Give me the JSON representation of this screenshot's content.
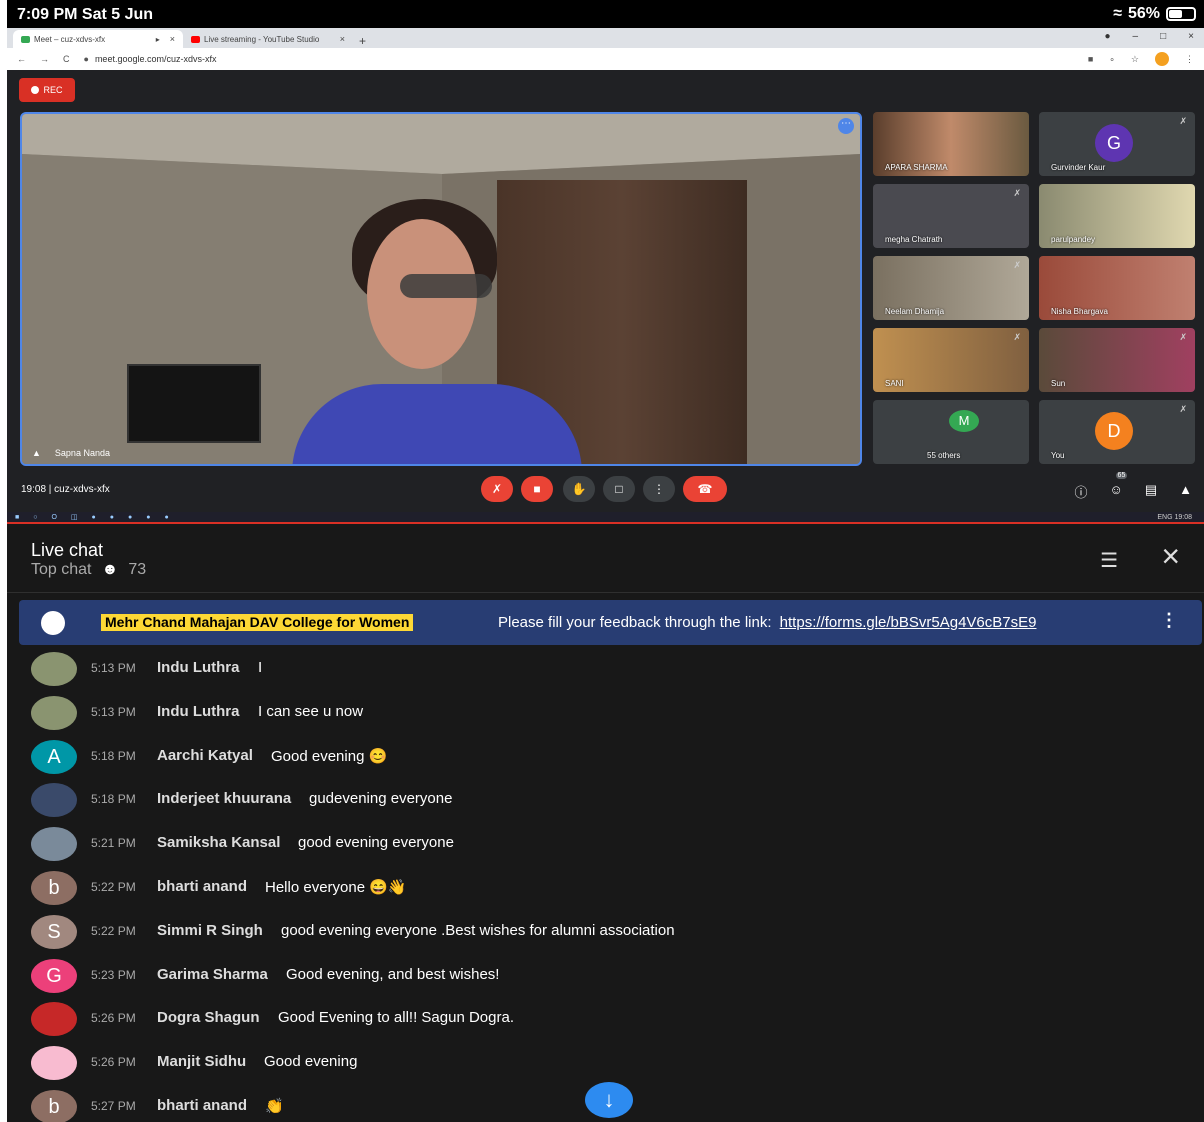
{
  "status_bar": {
    "time": "7:09 PM  Sat 5 Jun",
    "battery": "56%",
    "battery_level": 0.56
  },
  "browser": {
    "tabs": [
      {
        "label": "Meet – cuz-xdvs-xfx",
        "active": true,
        "color": "#34a853"
      },
      {
        "label": "Live streaming - YouTube Studio",
        "active": false,
        "color": "#ff0000"
      }
    ],
    "url": "meet.google.com/cuz-xdvs-xfx"
  },
  "meet": {
    "rec_label": "REC",
    "main_participant": "Sapna Nanda",
    "tiles": [
      {
        "name": "APARA SHARMA",
        "type": "video"
      },
      {
        "name": "Gurvinder Kaur",
        "type": "avatar",
        "initial": "G",
        "color": "#5e35b1"
      },
      {
        "name": "megha Chatrath",
        "type": "video"
      },
      {
        "name": "parulpandey",
        "type": "video"
      },
      {
        "name": "Neelam Dhamija",
        "type": "video"
      },
      {
        "name": "Nisha Bhargava",
        "type": "video"
      },
      {
        "name": "SANI",
        "type": "video"
      },
      {
        "name": "Sun",
        "type": "video"
      },
      {
        "name": "55 others",
        "type": "avatar",
        "initial": "M",
        "color": "#34a853"
      },
      {
        "name": "You",
        "type": "avatar",
        "initial": "D",
        "color": "#f4811f"
      }
    ],
    "meeting_info": "19:08  |  cuz-xdvs-xfx",
    "participant_count": "65"
  },
  "taskbar": {
    "clock": "ENG  19:08"
  },
  "live_chat": {
    "title": "Live chat",
    "mode": "Top chat",
    "viewer_count": "73",
    "pinned": {
      "author": "Mehr Chand Mahajan DAV College for Women",
      "message": "Please fill your feedback through the link:",
      "link": "https://forms.gle/bBSvr5Ag4V6cB7sE9"
    },
    "messages": [
      {
        "time": "5:13 PM",
        "author": "Indu Luthra",
        "text": "I",
        "avatar": "",
        "color": "#8a9470"
      },
      {
        "time": "5:13 PM",
        "author": "Indu Luthra",
        "text": "I can see u now",
        "avatar": "",
        "color": "#8a9470"
      },
      {
        "time": "5:18 PM",
        "author": "Aarchi Katyal",
        "text": "Good evening 😊",
        "avatar": "A",
        "color": "#0097a7"
      },
      {
        "time": "5:18 PM",
        "author": "Inderjeet khuurana",
        "text": "gudevening everyone",
        "avatar": "",
        "color": "#3a4a6a"
      },
      {
        "time": "5:21 PM",
        "author": "Samiksha Kansal",
        "text": "good evening everyone",
        "avatar": "",
        "color": "#7a8a9a"
      },
      {
        "time": "5:22 PM",
        "author": "bharti anand",
        "text": "Hello everyone 😄👋",
        "avatar": "b",
        "color": "#8d6e63"
      },
      {
        "time": "5:22 PM",
        "author": "Simmi R Singh",
        "text": "good evening everyone .Best wishes for alumni association",
        "avatar": "S",
        "color": "#a1887f"
      },
      {
        "time": "5:23 PM",
        "author": "Garima Sharma",
        "text": "Good evening, and best wishes!",
        "avatar": "G",
        "color": "#ec407a"
      },
      {
        "time": "5:26 PM",
        "author": "Dogra Shagun",
        "text": "Good Evening to all!! Sagun Dogra.",
        "avatar": "",
        "color": "#c62828"
      },
      {
        "time": "5:26 PM",
        "author": "Manjit Sidhu",
        "text": "Good evening",
        "avatar": "",
        "color": "#f8bbd0"
      },
      {
        "time": "5:27 PM",
        "author": "bharti anand",
        "text": "👏",
        "avatar": "b",
        "color": "#8d6e63"
      }
    ]
  }
}
